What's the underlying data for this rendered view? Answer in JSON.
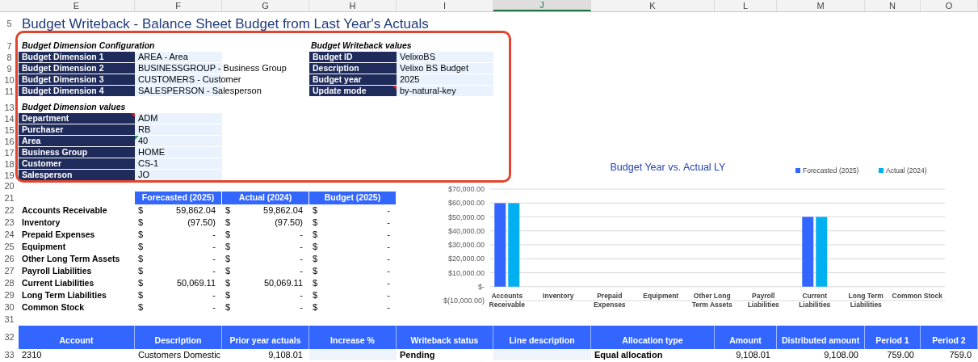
{
  "column_headers": [
    {
      "label": "E",
      "selected": false
    },
    {
      "label": "F",
      "selected": false
    },
    {
      "label": "G",
      "selected": false
    },
    {
      "label": "H",
      "selected": false
    },
    {
      "label": "I",
      "selected": false
    },
    {
      "label": "J",
      "selected": true
    },
    {
      "label": "K",
      "selected": false
    },
    {
      "label": "L",
      "selected": false
    },
    {
      "label": "M",
      "selected": false
    },
    {
      "label": "N",
      "selected": false
    },
    {
      "label": "O",
      "selected": false
    }
  ],
  "title": {
    "row": "5",
    "text": "Budget Writeback - Balance Sheet Budget from Last Year's Actuals"
  },
  "configuration": {
    "row": "7",
    "heading": "Budget Dimension Configuration",
    "rows": [
      {
        "row": "8",
        "label": "Budget Dimension 1",
        "value": "AREA - Area"
      },
      {
        "row": "9",
        "label": "Budget Dimension 2",
        "value": "BUSINESSGROUP - Business Group"
      },
      {
        "row": "10",
        "label": "Budget Dimension 3",
        "value": "CUSTOMERS - Customer"
      },
      {
        "row": "11",
        "label": "Budget Dimension 4",
        "value": "SALESPERSON - Salesperson"
      }
    ]
  },
  "writeback_values": {
    "heading": "Budget Writeback values",
    "rows": [
      {
        "label": "Budget ID",
        "value": "VelixoBS",
        "comment": false
      },
      {
        "label": "Description",
        "value": "Velixo BS Budget",
        "comment": false
      },
      {
        "label": "Budget year",
        "value": "2025",
        "comment": false
      },
      {
        "label": "Update mode",
        "value": "by-natural-key",
        "comment": true
      }
    ]
  },
  "dimension_values": {
    "row": "13",
    "heading": "Budget Dimension values",
    "rows": [
      {
        "row": "14",
        "label": "Department",
        "value": "ADM",
        "comment": true,
        "error": false
      },
      {
        "row": "15",
        "label": "Purchaser",
        "value": "RB",
        "comment": false,
        "error": false
      },
      {
        "row": "16",
        "label": "Area",
        "value": "40",
        "comment": false,
        "error": true
      },
      {
        "row": "17",
        "label": "Business Group",
        "value": "HOME",
        "comment": false,
        "error": false
      },
      {
        "row": "18",
        "label": "Customer",
        "value": "CS-1",
        "comment": false,
        "error": false
      },
      {
        "row": "19",
        "label": "Salesperson",
        "value": "JO",
        "comment": false,
        "error": false
      }
    ]
  },
  "blank_rows": [
    "20",
    "31"
  ],
  "summary": {
    "row": "21",
    "columns": [
      "Forecasted (2025)",
      "Actual (2024)",
      "Budget (2025)"
    ],
    "rows": [
      {
        "row": "22",
        "label": "Accounts Receivable",
        "cells": [
          {
            "symbol": "$",
            "amount": "59,862.04"
          },
          {
            "symbol": "$",
            "amount": "59,862.04"
          },
          {
            "symbol": "$",
            "amount": "-"
          }
        ]
      },
      {
        "row": "23",
        "label": "Inventory",
        "cells": [
          {
            "symbol": "$",
            "amount": "(97.50)"
          },
          {
            "symbol": "$",
            "amount": "(97.50)"
          },
          {
            "symbol": "$",
            "amount": "-"
          }
        ]
      },
      {
        "row": "24",
        "label": "Prepaid Expenses",
        "cells": [
          {
            "symbol": "$",
            "amount": "-"
          },
          {
            "symbol": "$",
            "amount": "-"
          },
          {
            "symbol": "$",
            "amount": "-"
          }
        ]
      },
      {
        "row": "25",
        "label": "Equipment",
        "cells": [
          {
            "symbol": "$",
            "amount": "-"
          },
          {
            "symbol": "$",
            "amount": "-"
          },
          {
            "symbol": "$",
            "amount": "-"
          }
        ]
      },
      {
        "row": "26",
        "label": "Other Long Term Assets",
        "cells": [
          {
            "symbol": "$",
            "amount": "-"
          },
          {
            "symbol": "$",
            "amount": "-"
          },
          {
            "symbol": "$",
            "amount": "-"
          }
        ]
      },
      {
        "row": "27",
        "label": "Payroll Liabilities",
        "cells": [
          {
            "symbol": "$",
            "amount": "-"
          },
          {
            "symbol": "$",
            "amount": "-"
          },
          {
            "symbol": "$",
            "amount": "-"
          }
        ]
      },
      {
        "row": "28",
        "label": "Current Liabilities",
        "cells": [
          {
            "symbol": "$",
            "amount": "50,069.11"
          },
          {
            "symbol": "$",
            "amount": "50,069.11"
          },
          {
            "symbol": "$",
            "amount": "-"
          }
        ]
      },
      {
        "row": "29",
        "label": "Long Term Liabilities",
        "cells": [
          {
            "symbol": "$",
            "amount": "-"
          },
          {
            "symbol": "$",
            "amount": "-"
          },
          {
            "symbol": "$",
            "amount": "-"
          }
        ]
      },
      {
        "row": "30",
        "label": "Common Stock",
        "cells": [
          {
            "symbol": "$",
            "amount": "-"
          },
          {
            "symbol": "$",
            "amount": "-"
          },
          {
            "symbol": "$",
            "amount": "-"
          }
        ]
      }
    ]
  },
  "chart": {
    "chart_data": {
      "type": "bar",
      "title": "Budget Year vs. Actual LY",
      "categories": [
        "Accounts Receivable",
        "Inventory",
        "Prepaid Expenses",
        "Equipment",
        "Other Long Term Assets",
        "Payroll Liabilities",
        "Current Liabilities",
        "Long Term Liabilities",
        "Common Stock"
      ],
      "series": [
        {
          "name": "Forecasted (2025)",
          "color": "#3366ff",
          "values": [
            59900,
            null,
            0,
            0,
            0,
            0,
            50100,
            0,
            0
          ]
        },
        {
          "name": "Actual (2024)",
          "color": "#00b0f0",
          "values": [
            59900,
            null,
            0,
            0,
            0,
            0,
            50100,
            0,
            0
          ]
        }
      ],
      "grid": true,
      "legend": true,
      "ylim": [
        -10000,
        70000
      ],
      "yticks": [
        {
          "value": -10000,
          "label": "$(10,000.00)"
        },
        {
          "value": 0,
          "label": "$-"
        },
        {
          "value": 10000,
          "label": "$10,000.00"
        },
        {
          "value": 20000,
          "label": "$20,000.00"
        },
        {
          "value": 30000,
          "label": "$30,000.00"
        },
        {
          "value": 40000,
          "label": "$40,000.00"
        },
        {
          "value": 50000,
          "label": "$50,000.00"
        },
        {
          "value": 60000,
          "label": "$60,000.00"
        },
        {
          "value": 70000,
          "label": "$70,000.00"
        }
      ]
    }
  },
  "detail": {
    "row": "32",
    "columns": [
      "Account",
      "Description",
      "Prior year actuals",
      "Increase %",
      "Writeback status",
      "Line description",
      "Allocation type",
      "Amount",
      "Distributed amount",
      "Period 1",
      "Period 2"
    ],
    "rows": [
      {
        "row": "33",
        "cells": [
          {
            "kind": "text",
            "text": "2310"
          },
          {
            "kind": "text",
            "text": "Customers Domestic"
          },
          {
            "kind": "number",
            "text": "9,108.01"
          },
          {
            "kind": "input"
          },
          {
            "kind": "bold",
            "text": "Pending"
          },
          {
            "kind": "input"
          },
          {
            "kind": "bold",
            "text": "Equal allocation"
          },
          {
            "kind": "number",
            "text": "9,108.01"
          },
          {
            "kind": "number",
            "text": "9,108.00"
          },
          {
            "kind": "number",
            "text": "759.00"
          },
          {
            "kind": "number",
            "text": "759.0"
          }
        ]
      }
    ]
  }
}
